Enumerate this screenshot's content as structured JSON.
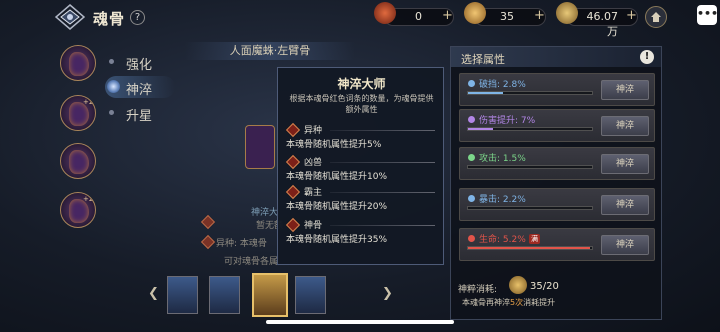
{
  "header": {
    "title": "魂骨",
    "help_label": "?",
    "resources": [
      {
        "name": "crimson-crystal",
        "value": "0",
        "plus": "+"
      },
      {
        "name": "soul-medal",
        "value": "35",
        "plus": "+"
      },
      {
        "name": "gold-coin",
        "value": "46.07万",
        "plus": "+"
      }
    ],
    "chat_label": "•••"
  },
  "sidebar": {
    "slots": [
      {
        "badge": ""
      },
      {
        "badge": "+24"
      },
      {
        "badge": ""
      },
      {
        "badge": "+24"
      }
    ],
    "tabs": [
      {
        "label": "强化",
        "active": false
      },
      {
        "label": "神淬",
        "active": true
      },
      {
        "label": "升星",
        "active": false
      }
    ]
  },
  "center": {
    "part_title": "人面魔蛛·左臂骨",
    "behind_text_1": "神淬大",
    "behind_text_2": "暂无额",
    "behind_text_3": "异种: 本魂骨",
    "behind_text_4": "可对魂骨各属"
  },
  "popup": {
    "title": "神淬大师",
    "description": "根据本魂骨红色词条的数量，为魂骨提供额外属性",
    "items": [
      {
        "name": "异种",
        "effect": "本魂骨随机属性提升5%"
      },
      {
        "name": "凶兽",
        "effect": "本魂骨随机属性提升10%"
      },
      {
        "name": "霸主",
        "effect": "本魂骨随机属性提升20%"
      },
      {
        "name": "神骨",
        "effect": "本魂骨随机属性提升35%"
      }
    ]
  },
  "panel": {
    "header": "选择属性",
    "info_label": "!",
    "attributes": [
      {
        "label": "破挡: 2.8%",
        "color": "#7fb4e6",
        "fill_pct": 0.28,
        "button": "神淬",
        "tag": ""
      },
      {
        "label": "伤害提升: 7%",
        "color": "#b286e6",
        "fill_pct": 0.2,
        "button": "神淬",
        "tag": ""
      },
      {
        "label": "攻击: 1.5%",
        "color": "#7cd68a",
        "fill_pct": 0.0,
        "button": "神淬",
        "tag": ""
      },
      {
        "label": "暴击: 2.2%",
        "color": "#7fb4e6",
        "fill_pct": 0.0,
        "button": "神淬",
        "tag": ""
      },
      {
        "label": "生命: 5.2%",
        "color": "#e2544a",
        "fill_pct": 0.98,
        "button": "神淬",
        "tag": "满"
      }
    ],
    "cost_label": "神粹消耗:",
    "cost_value": "35/20",
    "note_prefix": "本魂骨再神淬",
    "note_highlight": "5次",
    "note_suffix": "消耗提升"
  },
  "bottom": {
    "left_arrow": "❮",
    "right_arrow": "❯"
  }
}
